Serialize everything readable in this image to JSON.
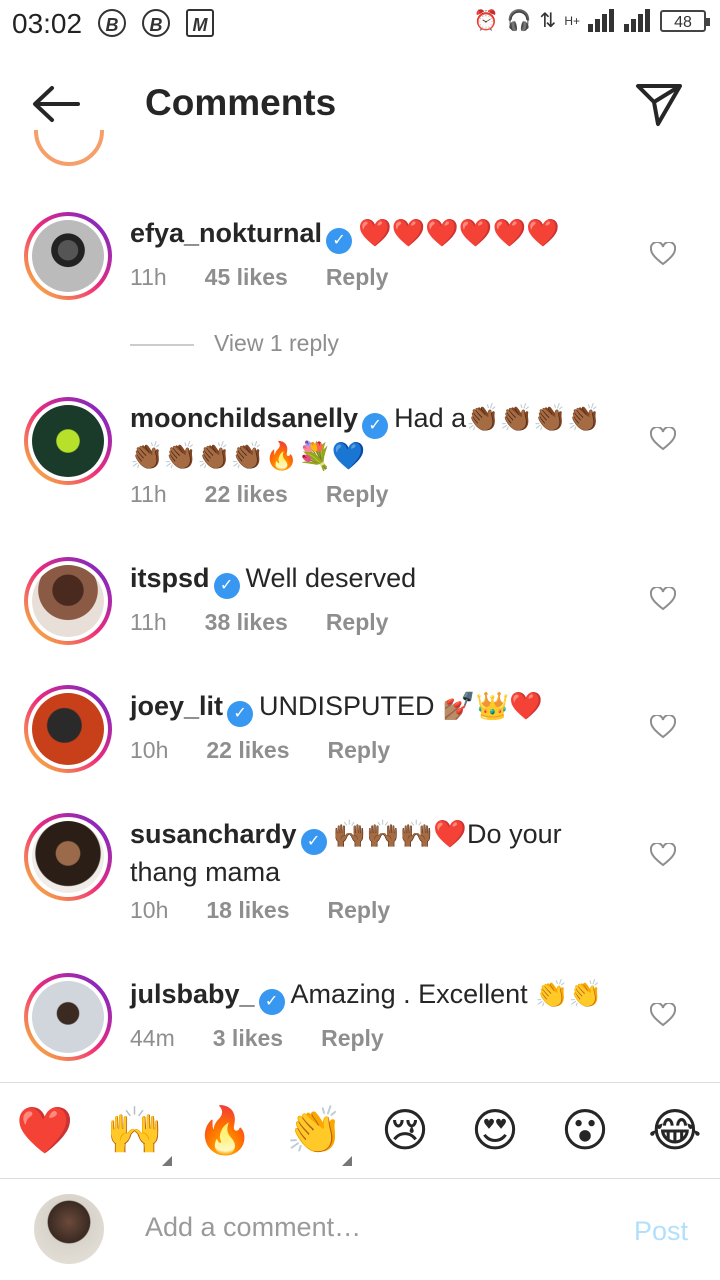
{
  "status": {
    "time": "03:02",
    "battery": "48",
    "network": "H+"
  },
  "header": {
    "title": "Comments"
  },
  "comments": [
    {
      "username": "efya_nokturnal",
      "text": "❤️❤️❤️❤️❤️❤️",
      "time": "11h",
      "likes": "45 likes",
      "reply": "Reply",
      "view_replies": "View 1 reply"
    },
    {
      "username": "moonchildsanelly",
      "text": "Had a👏🏾👏🏾👏🏾👏🏾👏🏾👏🏾👏🏾👏🏾🔥💐💙",
      "time": "11h",
      "likes": "22 likes",
      "reply": "Reply"
    },
    {
      "username": "itspsd",
      "text": "Well deserved",
      "time": "11h",
      "likes": "38 likes",
      "reply": "Reply"
    },
    {
      "username": "joey_lit",
      "text": "UNDISPUTED 💅🏽👑❤️",
      "time": "10h",
      "likes": "22 likes",
      "reply": "Reply"
    },
    {
      "username": "susanchardy",
      "text": "🙌🏾🙌🏾🙌🏾❤️Do your thang mama",
      "time": "10h",
      "likes": "18 likes",
      "reply": "Reply"
    },
    {
      "username": "julsbaby_",
      "text": "Amazing . Excellent 👏👏",
      "time": "44m",
      "likes": "3 likes",
      "reply": "Reply"
    }
  ],
  "emoji_bar": [
    "❤️",
    "🙌",
    "🔥",
    "👏",
    "😢",
    "😍",
    "😮",
    "😂"
  ],
  "compose": {
    "placeholder": "Add a comment…",
    "post_label": "Post"
  },
  "colors": {
    "link_blue": "#3897f0",
    "muted": "#8e8e8e",
    "post_disabled": "#b2dffc"
  }
}
